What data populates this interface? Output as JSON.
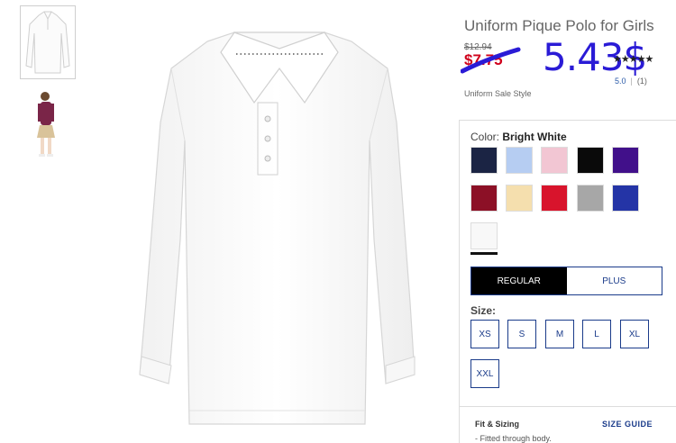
{
  "product": {
    "title": "Uniform Pique Polo for Girls",
    "old_price": "$12.94",
    "sale_price": "$7.75",
    "overlay_price": "5.43$",
    "stars": "★★★★★",
    "rating_value": "5.0",
    "rating_count": "(1)",
    "sale_style": "Uniform Sale Style"
  },
  "color": {
    "label": "Color:",
    "selected": "Bright White",
    "swatches": [
      {
        "name": "navy",
        "hex": "#1b2444"
      },
      {
        "name": "light-blue",
        "hex": "#b6cdf2"
      },
      {
        "name": "pink",
        "hex": "#f2c6d3"
      },
      {
        "name": "black",
        "hex": "#0a0a0a"
      },
      {
        "name": "purple",
        "hex": "#41108a"
      },
      {
        "name": "burgundy",
        "hex": "#8c1026"
      },
      {
        "name": "yellow",
        "hex": "#f5dfae"
      },
      {
        "name": "red",
        "hex": "#d8142c"
      },
      {
        "name": "heather-gray",
        "hex": "#a7a7a7"
      },
      {
        "name": "royal-blue",
        "hex": "#2434a6"
      },
      {
        "name": "bright-white",
        "hex": "#f8f8f8"
      }
    ]
  },
  "fit": {
    "regular": "REGULAR",
    "plus": "PLUS"
  },
  "size": {
    "label": "Size:",
    "options": [
      "XS",
      "S",
      "M",
      "L",
      "XL",
      "XXL"
    ]
  },
  "fit_sizing": {
    "title": "Fit & Sizing",
    "guide": "SIZE GUIDE",
    "note": "- Fitted through body."
  },
  "colors": {
    "accent": "#1a3b8a",
    "sale": "#d0011b",
    "overlay": "#2a1bd6"
  }
}
